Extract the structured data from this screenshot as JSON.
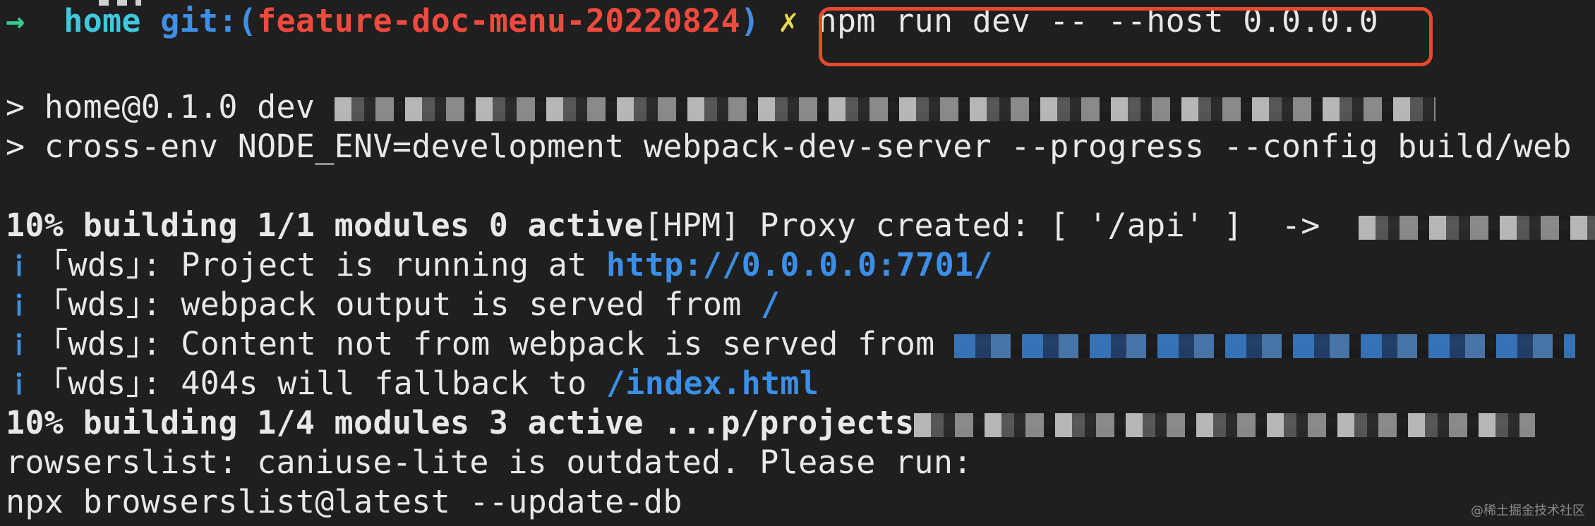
{
  "prompt": {
    "arrow": "→",
    "dir": "home",
    "git_label": "git:(",
    "branch": "feature-doc-menu-20220824",
    "git_close": ")",
    "dirty": "✗",
    "command": "npm run dev -- --host 0.0.0.0"
  },
  "output": {
    "line1": "> home@0.1.0 dev ",
    "line2": "> cross-env NODE_ENV=development webpack-dev-server --progress --config build/web",
    "line3_bold": "10% building 1/1 modules 0 active",
    "line3_rest": "[HPM] Proxy created: [ '/api' ]  ->  ",
    "wds_prefix": "i ｢wds｣",
    "line4_text": ": Project is running at ",
    "line4_url": "http://0.0.0.0:7701/",
    "line5_text": ": webpack output is served from ",
    "line5_url": "/",
    "line6_text": ": Content not from webpack is served from ",
    "line7_text": ": 404s will fallback to ",
    "line7_url": "/index.html",
    "line8_bold": "10% building 1/4 modules 3 active ...p/projects",
    "line9": "rowserslist: caniuse-lite is outdated. Please run:",
    "line10": "npx browserslist@latest --update-db"
  },
  "watermark": "@稀土掘金技术社区"
}
